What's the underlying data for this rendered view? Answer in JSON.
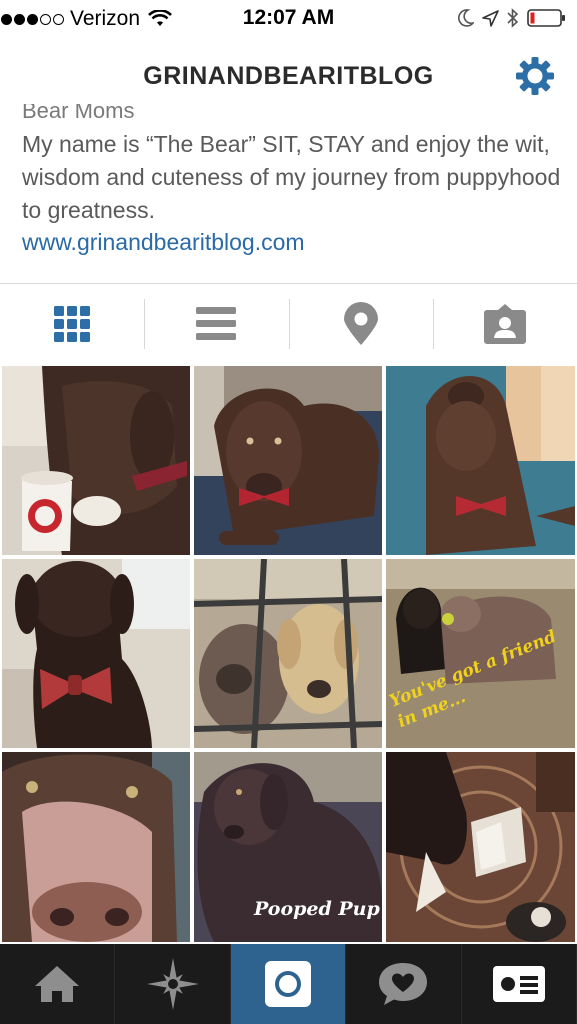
{
  "status_bar": {
    "carrier": "Verizon",
    "signal_bars_filled": 3,
    "signal_bars_total": 5,
    "time": "12:07 AM",
    "battery_level": 0.1
  },
  "header": {
    "title": "GRINANDBEARITBLOG",
    "settings_icon": "gear-icon",
    "accent_color": "#2e6ea6"
  },
  "profile": {
    "cut_off_line": "Bear Moms",
    "bio": "My name is “The Bear” SIT, STAY and enjoy the wit, wisdom and cuteness of my journey from puppyhood to greatness.",
    "website": "www.grinandbearitblog.com"
  },
  "view_tabs": [
    {
      "icon": "grid-icon",
      "active": true
    },
    {
      "icon": "list-icon",
      "active": false
    },
    {
      "icon": "location-pin-icon",
      "active": false
    },
    {
      "icon": "tagged-person-icon",
      "active": false
    }
  ],
  "photos": [
    {
      "subject": "puppy drinking from cup"
    },
    {
      "subject": "dog lying with red bow tie"
    },
    {
      "subject": "dog looking up with bow tie"
    },
    {
      "subject": "dog in car with bow tie"
    },
    {
      "subject": "two dogs behind gate"
    },
    {
      "subject": "two dogs in yard",
      "caption": "You've got a friend in me..."
    },
    {
      "subject": "close up dog face"
    },
    {
      "subject": "puppy on couch",
      "caption": "Pooped Pup"
    },
    {
      "subject": "puppy on rug with box"
    }
  ],
  "tab_bar": [
    {
      "icon": "home-icon",
      "active": false
    },
    {
      "icon": "explore-icon",
      "active": false
    },
    {
      "icon": "camera-icon",
      "active": true
    },
    {
      "icon": "activity-heart-icon",
      "active": false
    },
    {
      "icon": "profile-card-icon",
      "active": false
    }
  ]
}
